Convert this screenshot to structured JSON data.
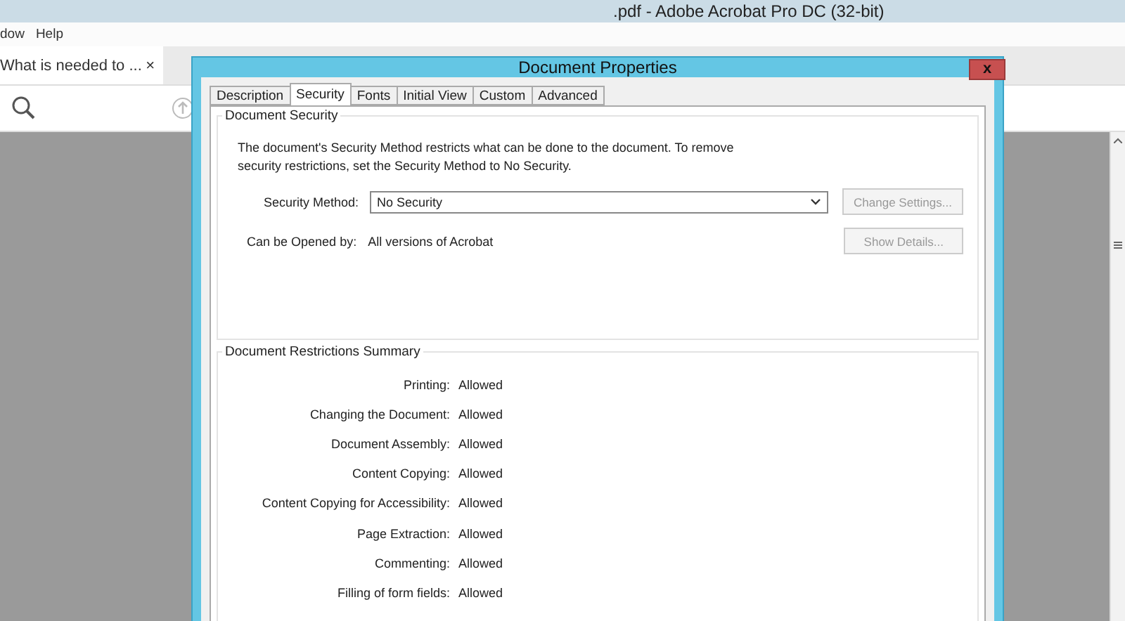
{
  "app": {
    "title": ".pdf - Adobe Acrobat Pro DC (32-bit)",
    "menu": [
      "dow",
      "Help"
    ],
    "doc_tab": {
      "label": "What is needed to ...",
      "close": "×"
    }
  },
  "dialog": {
    "title": "Document Properties",
    "close": "x",
    "tabs": [
      {
        "label": "Description",
        "selected": false
      },
      {
        "label": "Security",
        "selected": true
      },
      {
        "label": "Fonts",
        "selected": false
      },
      {
        "label": "Initial View",
        "selected": false
      },
      {
        "label": "Custom",
        "selected": false
      },
      {
        "label": "Advanced",
        "selected": false
      }
    ],
    "security": {
      "heading": "Document Security",
      "description": "The document's Security Method restricts what can be done to the document. To remove security restrictions, set the Security Method to No Security.",
      "method_label": "Security Method:",
      "method_value": "No Security",
      "change_button": {
        "label": "Change Settings...",
        "disabled": true
      },
      "opened_label": "Can be Opened by:",
      "opened_value": "All versions of Acrobat",
      "details_button": {
        "label": "Show Details...",
        "disabled": true
      }
    },
    "restrictions": {
      "heading": "Document Restrictions Summary",
      "rows": [
        {
          "label": "Printing:",
          "value": "Allowed"
        },
        {
          "label": "Changing the Document:",
          "value": "Allowed"
        },
        {
          "label": "Document Assembly:",
          "value": "Allowed"
        },
        {
          "label": "Content Copying:",
          "value": "Allowed"
        },
        {
          "label": "Content Copying for Accessibility:",
          "value": "Allowed"
        },
        {
          "label": "Page Extraction:",
          "value": "Allowed"
        },
        {
          "label": "Commenting:",
          "value": "Allowed"
        },
        {
          "label": "Filling of form fields:",
          "value": "Allowed"
        }
      ]
    }
  }
}
